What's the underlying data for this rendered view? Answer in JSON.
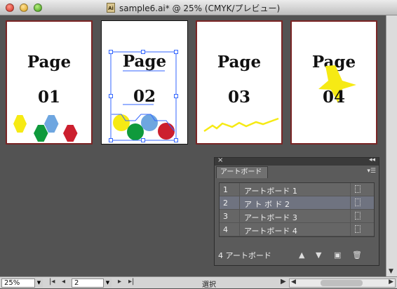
{
  "window": {
    "title": "sample6.ai* @ 25% (CMYK/プレビュー)",
    "doc_icon": "Ai"
  },
  "artboards": [
    {
      "line1": "Page",
      "line2": "01"
    },
    {
      "line1": "Page",
      "line2": "02"
    },
    {
      "line1": "Page",
      "line2": "03"
    },
    {
      "line1": "Page",
      "line2": "04"
    }
  ],
  "colors": {
    "yellow": "#f6ea14",
    "green": "#0f9a3c",
    "blue": "#6ea6e0",
    "red": "#cc1f2e",
    "selection": "#3366ff"
  },
  "panel": {
    "tab": "アートボード",
    "rows": [
      {
        "num": "1",
        "name": "アートボード 1"
      },
      {
        "num": "2",
        "name": "ア  ト ボ ド 2"
      },
      {
        "num": "3",
        "name": "アートボード 3"
      },
      {
        "num": "4",
        "name": "アートボード 4"
      }
    ],
    "selected_index": 1,
    "count": "4 アートボード"
  },
  "statusbar": {
    "zoom": "25%",
    "page": "2",
    "tool": "選択"
  }
}
